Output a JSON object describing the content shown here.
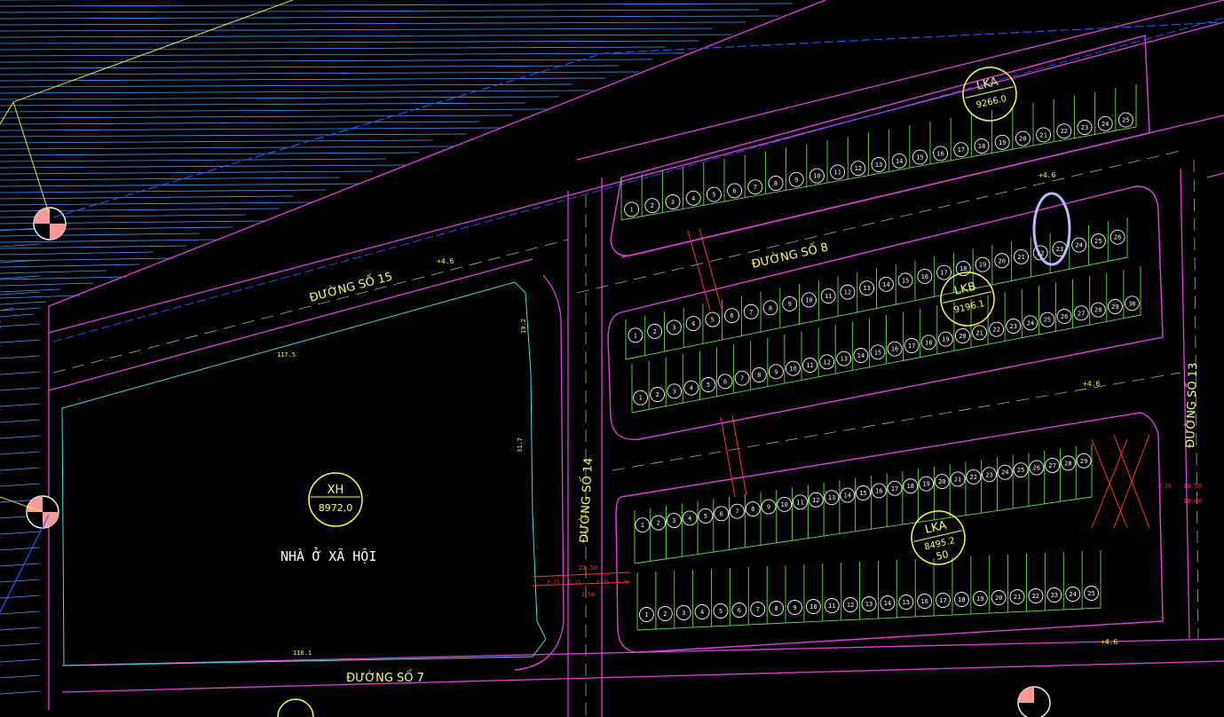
{
  "streets": {
    "s15": "ĐƯỜNG SỐ 15",
    "s8": "ĐƯỜNG SỐ 8",
    "s14": "ĐƯỜNG SỐ 14",
    "s13": "ĐƯỜNG SỐ 13",
    "s7": "ĐƯỜNG SỐ 7"
  },
  "social_housing": {
    "code": "XH",
    "area": "8972,0",
    "name": "NHÀ Ở XÃ HỘI"
  },
  "blocks": {
    "top": {
      "code": "LKA",
      "area": "9266.0"
    },
    "middle": {
      "code": "LKB",
      "area": "9196.1"
    },
    "bottom": {
      "code": "LKA",
      "area": "8495.2",
      "suffix": "50"
    }
  },
  "dims": {
    "w1175": "117.5",
    "h192": "19.2",
    "h317": "31.7",
    "w1161": "116.1",
    "e46a": "+4.6",
    "e46b": "+4.6",
    "e46c": "+4.6",
    "e46d": "+4.6",
    "r2150": "21.50",
    "r575a": "3.75",
    "r515": "5.15",
    "r575b": "5.75",
    "r375": "3.75",
    "r2150b": "2.50",
    "r1050": "10.50",
    "r1800": "18.00",
    "r375b": "3.75"
  },
  "lots": {
    "top": [
      "1",
      "2",
      "3",
      "4",
      "5",
      "6",
      "7",
      "8",
      "9",
      "10",
      "11",
      "12",
      "13",
      "14",
      "15",
      "16",
      "17",
      "18",
      "19",
      "20",
      "21",
      "22",
      "23",
      "24",
      "25"
    ],
    "middle_upper": [
      "1",
      "2",
      "3",
      "4",
      "5",
      "6",
      "7",
      "8",
      "9",
      "10",
      "11",
      "12",
      "13",
      "14",
      "15",
      "16",
      "17",
      "18",
      "19",
      "20",
      "21",
      "22",
      "23",
      "24",
      "25",
      "26"
    ],
    "middle_lower": [
      "1",
      "2",
      "3",
      "4",
      "5",
      "6",
      "7",
      "8",
      "9",
      "10",
      "11",
      "12",
      "13",
      "14",
      "15",
      "16",
      "17",
      "18",
      "19",
      "20",
      "21",
      "22",
      "23",
      "24",
      "25",
      "26",
      "27",
      "28",
      "29",
      "30"
    ],
    "bottom_upper": [
      "1",
      "2",
      "3",
      "4",
      "5",
      "6",
      "7",
      "8",
      "9",
      "10",
      "11",
      "12",
      "13",
      "14",
      "15",
      "16",
      "17",
      "18",
      "19",
      "20",
      "21",
      "22",
      "23",
      "24",
      "25",
      "26",
      "27",
      "28",
      "29"
    ],
    "bottom_lower": [
      "1",
      "2",
      "3",
      "4",
      "5",
      "6",
      "7",
      "8",
      "9",
      "10",
      "11",
      "12",
      "13",
      "14",
      "15",
      "16",
      "17",
      "18",
      "19",
      "20",
      "21",
      "22",
      "23",
      "24",
      "25"
    ]
  },
  "colors": {
    "background": "#000000",
    "road_edge": "#e040e0",
    "lot_line": "#66dd44",
    "water": "#3aa0ff",
    "label": "#ffff66",
    "marker": "#ff9999",
    "highlight": "#b8b0ff"
  }
}
